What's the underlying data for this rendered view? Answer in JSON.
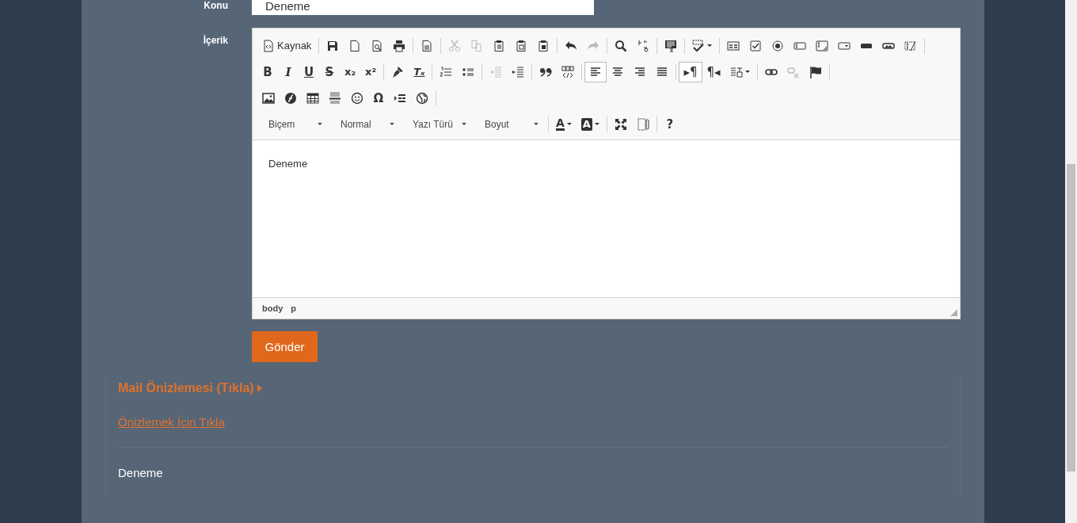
{
  "form": {
    "subject": {
      "label": "Konu",
      "value": "Deneme"
    },
    "content_label": "İçerik"
  },
  "editor": {
    "toolbar_rows": [
      [
        {
          "buttons": [
            {
              "kind": "source",
              "label": "Kaynak",
              "disabled": false,
              "pressed": false
            }
          ]
        },
        {
          "buttons": [
            {
              "kind": "save",
              "disabled": false,
              "pressed": false
            },
            {
              "kind": "newpage",
              "disabled": false,
              "pressed": false
            },
            {
              "kind": "preview",
              "disabled": false,
              "pressed": false
            },
            {
              "kind": "print",
              "disabled": false,
              "pressed": false
            }
          ]
        },
        {
          "buttons": [
            {
              "kind": "templates",
              "disabled": false,
              "pressed": false
            }
          ]
        },
        {
          "buttons": [
            {
              "kind": "cut",
              "disabled": true,
              "pressed": false
            },
            {
              "kind": "copy",
              "disabled": true,
              "pressed": false
            },
            {
              "kind": "paste",
              "disabled": false,
              "pressed": false
            },
            {
              "kind": "pastetext",
              "disabled": false,
              "pressed": false
            },
            {
              "kind": "pasteword",
              "disabled": false,
              "pressed": false
            }
          ]
        },
        {
          "buttons": [
            {
              "kind": "undo",
              "disabled": false,
              "pressed": false
            },
            {
              "kind": "redo",
              "disabled": true,
              "pressed": false
            }
          ]
        },
        {
          "buttons": [
            {
              "kind": "find",
              "disabled": false,
              "pressed": false
            },
            {
              "kind": "replace",
              "disabled": false,
              "pressed": false
            }
          ]
        },
        {
          "buttons": [
            {
              "kind": "selectall",
              "disabled": false,
              "pressed": false
            }
          ]
        },
        {
          "buttons": [
            {
              "kind": "spellcheck",
              "dropdown": true,
              "disabled": false,
              "pressed": false
            }
          ]
        },
        {
          "buttons": [
            {
              "kind": "form",
              "disabled": false,
              "pressed": false
            },
            {
              "kind": "checkbox",
              "disabled": false,
              "pressed": false
            },
            {
              "kind": "radio",
              "disabled": false,
              "pressed": false
            },
            {
              "kind": "textfield",
              "disabled": false,
              "pressed": false
            },
            {
              "kind": "textarea",
              "disabled": false,
              "pressed": false
            },
            {
              "kind": "select",
              "disabled": false,
              "pressed": false
            },
            {
              "kind": "button",
              "disabled": false,
              "pressed": false
            },
            {
              "kind": "imagebutton",
              "disabled": false,
              "pressed": false
            },
            {
              "kind": "hiddenfield",
              "disabled": false,
              "pressed": false
            }
          ]
        }
      ],
      [
        {
          "buttons": [
            {
              "kind": "bold",
              "glyph": "B",
              "disabled": false,
              "pressed": false
            },
            {
              "kind": "italic",
              "glyph": "I",
              "disabled": false,
              "pressed": false
            },
            {
              "kind": "underline",
              "glyph": "U",
              "disabled": false,
              "pressed": false
            },
            {
              "kind": "strike",
              "glyph": "S",
              "disabled": false,
              "pressed": false
            },
            {
              "kind": "subscript",
              "glyph": "x₂",
              "disabled": false,
              "pressed": false
            },
            {
              "kind": "superscript",
              "glyph": "x²",
              "disabled": false,
              "pressed": false
            }
          ]
        },
        {
          "buttons": [
            {
              "kind": "copyformat",
              "disabled": false,
              "pressed": false
            },
            {
              "kind": "removeformat",
              "glyph": "Tₓ",
              "disabled": false,
              "pressed": false
            }
          ]
        },
        {
          "buttons": [
            {
              "kind": "numberedlist",
              "disabled": false,
              "pressed": false
            },
            {
              "kind": "bulletedlist",
              "disabled": false,
              "pressed": false
            }
          ]
        },
        {
          "buttons": [
            {
              "kind": "outdent",
              "disabled": true,
              "pressed": false
            },
            {
              "kind": "indent",
              "disabled": false,
              "pressed": false
            }
          ]
        },
        {
          "buttons": [
            {
              "kind": "blockquote",
              "disabled": false,
              "pressed": false
            },
            {
              "kind": "creatediv",
              "disabled": false,
              "pressed": false
            }
          ]
        },
        {
          "buttons": [
            {
              "kind": "alignleft",
              "disabled": false,
              "pressed": true
            },
            {
              "kind": "aligncenter",
              "disabled": false,
              "pressed": false
            },
            {
              "kind": "alignright",
              "disabled": false,
              "pressed": false
            },
            {
              "kind": "alignjustify",
              "disabled": false,
              "pressed": false
            }
          ]
        },
        {
          "buttons": [
            {
              "kind": "ltr",
              "glyph": "▸¶",
              "disabled": false,
              "pressed": true
            },
            {
              "kind": "rtl",
              "glyph": "¶◂",
              "disabled": false,
              "pressed": false
            },
            {
              "kind": "language",
              "dropdown": true,
              "disabled": false,
              "pressed": false
            }
          ]
        },
        {
          "buttons": [
            {
              "kind": "link",
              "disabled": false,
              "pressed": false
            },
            {
              "kind": "unlink",
              "disabled": true,
              "pressed": false
            },
            {
              "kind": "anchor",
              "disabled": false,
              "pressed": false
            }
          ]
        }
      ],
      [
        {
          "buttons": [
            {
              "kind": "image",
              "disabled": false,
              "pressed": false
            },
            {
              "kind": "flash",
              "disabled": false,
              "pressed": false
            },
            {
              "kind": "table",
              "disabled": false,
              "pressed": false
            },
            {
              "kind": "hr",
              "disabled": false,
              "pressed": false
            },
            {
              "kind": "smiley",
              "disabled": false,
              "pressed": false
            },
            {
              "kind": "specialchar",
              "glyph": "Ω",
              "disabled": false,
              "pressed": false
            },
            {
              "kind": "pagebreak",
              "disabled": false,
              "pressed": false
            },
            {
              "kind": "iframe",
              "disabled": false,
              "pressed": false
            }
          ]
        }
      ],
      [
        {
          "buttons": [
            {
              "kind": "combo",
              "label": "Biçem",
              "disabled": false,
              "pressed": false
            },
            {
              "kind": "combo",
              "label": "Normal",
              "disabled": false,
              "pressed": false
            },
            {
              "kind": "combo",
              "label": "Yazı Türü",
              "disabled": false,
              "pressed": false
            },
            {
              "kind": "combo",
              "label": "Boyut",
              "disabled": false,
              "pressed": false
            }
          ]
        },
        {
          "buttons": [
            {
              "kind": "textcolor",
              "glyph": "A",
              "dropdown": true,
              "disabled": false,
              "pressed": false
            },
            {
              "kind": "bgcolor",
              "glyph": "A",
              "dropdown": true,
              "disabled": false,
              "pressed": false
            }
          ]
        },
        {
          "buttons": [
            {
              "kind": "maximize",
              "disabled": false,
              "pressed": false
            },
            {
              "kind": "showblocks",
              "disabled": false,
              "pressed": false
            }
          ]
        },
        {
          "buttons": [
            {
              "kind": "about",
              "glyph": "?",
              "disabled": false,
              "pressed": false
            }
          ]
        }
      ]
    ],
    "content": "Deneme",
    "path": [
      "body",
      "p"
    ]
  },
  "submit": "Gönder",
  "preview": {
    "heading": "Mail Önizlemesi (Tıkla)",
    "link": "Önizlemek İçin Tıkla",
    "body": "Deneme"
  }
}
